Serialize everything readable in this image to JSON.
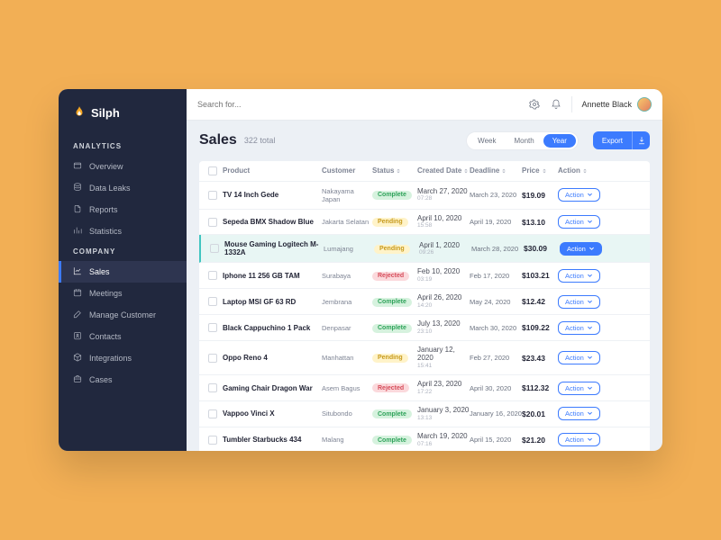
{
  "brand": "Silph",
  "sidebar": {
    "sections": [
      {
        "title": "ANALYTICS",
        "items": [
          {
            "icon": "card-icon",
            "label": "Overview"
          },
          {
            "icon": "database-icon",
            "label": "Data Leaks"
          },
          {
            "icon": "file-icon",
            "label": "Reports"
          },
          {
            "icon": "bars-icon",
            "label": "Statistics"
          }
        ]
      },
      {
        "title": "COMPANY",
        "items": [
          {
            "icon": "chart-icon",
            "label": "Sales",
            "active": true
          },
          {
            "icon": "calendar-icon",
            "label": "Meetings"
          },
          {
            "icon": "pencil-icon",
            "label": "Manage Customer"
          },
          {
            "icon": "contact-icon",
            "label": "Contacts"
          },
          {
            "icon": "cube-icon",
            "label": "Integrations"
          },
          {
            "icon": "briefcase-icon",
            "label": "Cases"
          }
        ]
      }
    ]
  },
  "search_placeholder": "Search for...",
  "user_name": "Annette Black",
  "page": {
    "title": "Sales",
    "subtitle": "322 total"
  },
  "periods": [
    "Week",
    "Month",
    "Year"
  ],
  "period_active": 2,
  "export_label": "Export",
  "columns": [
    "",
    "Product",
    "Customer",
    "Status",
    "Created Date",
    "Deadline",
    "Price",
    "Action"
  ],
  "action_label": "Action",
  "rows": [
    {
      "product": "TV 14 Inch Gede",
      "customer": "Nakayama Japan",
      "status": "Complete",
      "created": "March 27, 2020",
      "created_t": "07:28",
      "deadline": "March 23, 2020",
      "price": "$19.09"
    },
    {
      "product": "Sepeda BMX Shadow Blue",
      "customer": "Jakarta Selatan",
      "status": "Pending",
      "created": "April 10, 2020",
      "created_t": "15:58",
      "deadline": "April 19, 2020",
      "price": "$13.10"
    },
    {
      "product": "Mouse Gaming Logitech M-1332A",
      "customer": "Lumajang",
      "status": "Pending",
      "created": "April 1, 2020",
      "created_t": "09:26",
      "deadline": "March 28, 2020",
      "price": "$30.09",
      "highlight": true
    },
    {
      "product": "Iphone 11 256 GB TAM",
      "customer": "Surabaya",
      "status": "Rejected",
      "created": "Feb 10, 2020",
      "created_t": "03:19",
      "deadline": "Feb 17, 2020",
      "price": "$103.21"
    },
    {
      "product": "Laptop MSI GF 63 RD",
      "customer": "Jembrana",
      "status": "Complete",
      "created": "April 26, 2020",
      "created_t": "14:20",
      "deadline": "May 24, 2020",
      "price": "$12.42"
    },
    {
      "product": "Black Cappuchino 1 Pack",
      "customer": "Denpasar",
      "status": "Complete",
      "created": "July 13, 2020",
      "created_t": "23:10",
      "deadline": "March 30, 2020",
      "price": "$109.22"
    },
    {
      "product": "Oppo Reno 4",
      "customer": "Manhattan",
      "status": "Pending",
      "created": "January 12, 2020",
      "created_t": "15:41",
      "deadline": "Feb 27, 2020",
      "price": "$23.43"
    },
    {
      "product": "Gaming Chair Dragon War",
      "customer": "Asem Bagus",
      "status": "Rejected",
      "created": "April 23, 2020",
      "created_t": "17:22",
      "deadline": "April 30, 2020",
      "price": "$112.32"
    },
    {
      "product": "Vappoo Vinci X",
      "customer": "Situbondo",
      "status": "Complete",
      "created": "January 3, 2020",
      "created_t": "13:13",
      "deadline": "January 16, 2020",
      "price": "$20.01"
    },
    {
      "product": "Tumbler Starbucks 434",
      "customer": "Malang",
      "status": "Complete",
      "created": "March 19, 2020",
      "created_t": "07:16",
      "deadline": "April 15, 2020",
      "price": "$21.20"
    }
  ]
}
